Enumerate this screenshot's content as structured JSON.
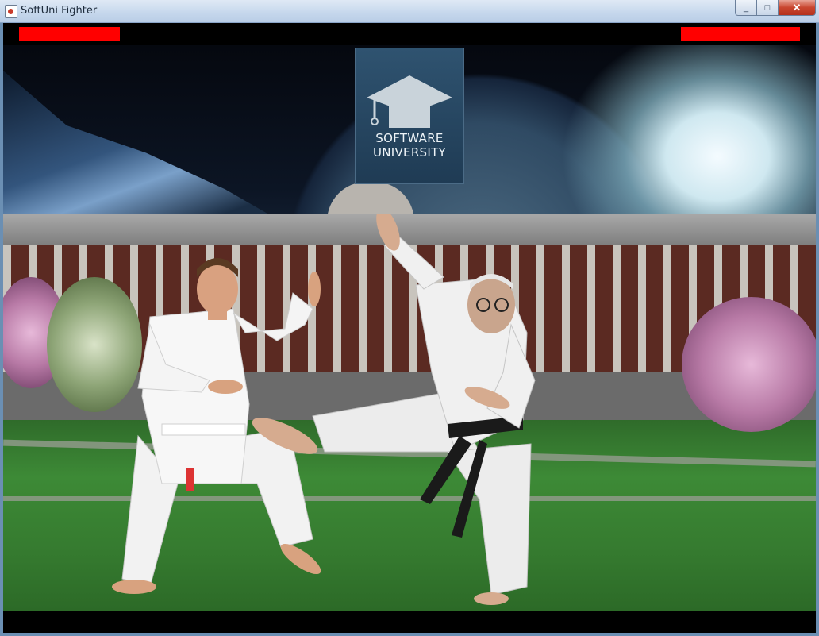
{
  "window": {
    "title": "SoftUni Fighter",
    "minimize_label": "_",
    "maximize_label": "□",
    "close_label": "✕"
  },
  "logo": {
    "line1": "SOFTWARE",
    "line2": "UNIVERSITY"
  },
  "hud": {
    "health_color": "#ff0000",
    "player1_health": 1.0,
    "player2_health": 1.0
  },
  "scene": {
    "background": "campus-building-with-planet-sky",
    "player1": "karate-fighter-white-belt",
    "player2": "karate-fighter-black-belt"
  }
}
